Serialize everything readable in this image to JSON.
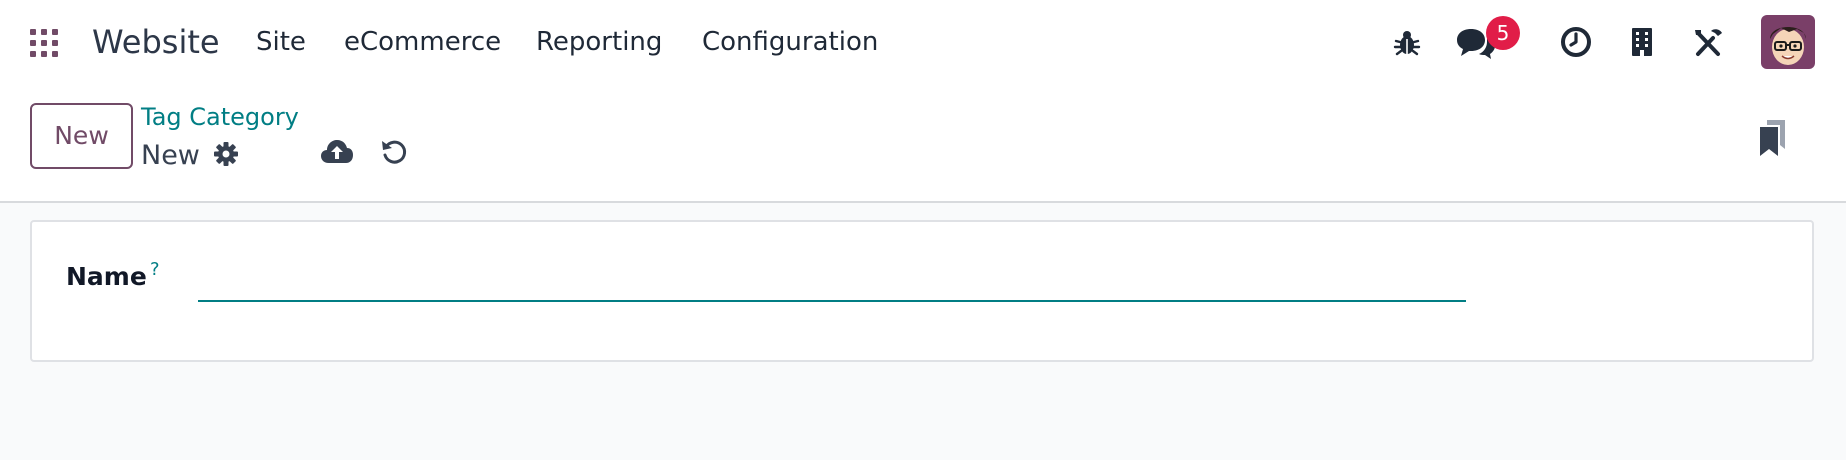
{
  "navbar": {
    "app_name": "Website",
    "menu": [
      "Site",
      "eCommerce",
      "Reporting",
      "Configuration"
    ],
    "icons": [
      "apps-grid-icon",
      "bug-icon",
      "chat-icon",
      "clock-icon",
      "building-icon",
      "tools-icon"
    ],
    "messages_badge": "5",
    "badge_color": "#e11d48",
    "accent_color": "#714b67"
  },
  "control_panel": {
    "new_button_label": "New",
    "breadcrumb": "Tag Category",
    "record_title": "New",
    "icons": [
      "gear-icon",
      "cloud-upload-icon",
      "undo-icon",
      "bookmark-icon"
    ]
  },
  "form": {
    "name_label": "Name",
    "name_help": "?",
    "name_value": "",
    "focus_color": "#017e84"
  }
}
